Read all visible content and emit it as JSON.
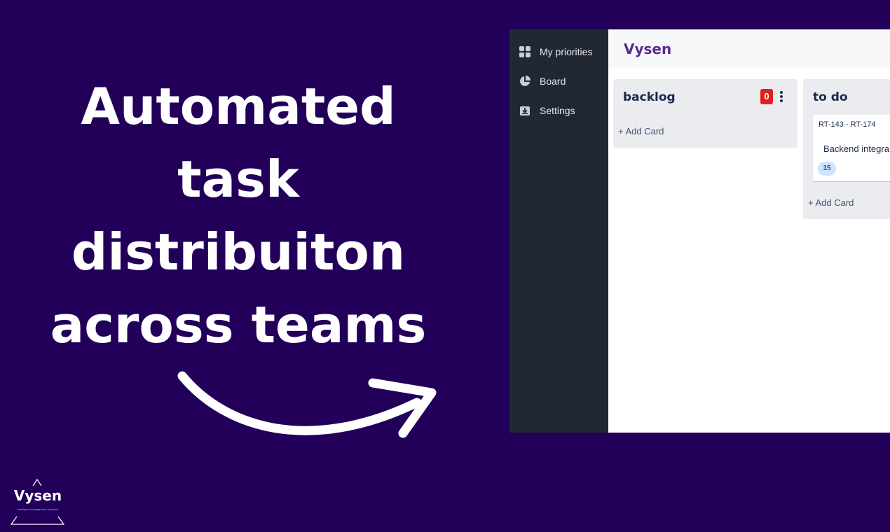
{
  "headline": {
    "lines": [
      "Automated",
      "task",
      "distribuiton",
      "across teams"
    ]
  },
  "logo": {
    "name": "Vysen",
    "tagline": "Intelligent management solutions"
  },
  "app": {
    "title": "Vysen",
    "sidebar": {
      "items": [
        {
          "label": "My priorities",
          "icon": "grid-icon"
        },
        {
          "label": "Board",
          "icon": "pie-chart-icon"
        },
        {
          "label": "Settings",
          "icon": "settings-icon"
        }
      ]
    },
    "columns": [
      {
        "title": "backlog",
        "count": "0",
        "add_label": "+ Add Card",
        "cards": []
      },
      {
        "title": "to do",
        "add_label": "+ Add Card",
        "cards": [
          {
            "key": "RT-143 - RT-174",
            "title": "Backend integra",
            "badge": "15"
          }
        ]
      }
    ]
  },
  "colors": {
    "background": "#22005a",
    "sidebar": "#212833",
    "brand": "#5b2b8a",
    "count_badge": "#e0201b",
    "card_badge": "#cfe2ff"
  }
}
